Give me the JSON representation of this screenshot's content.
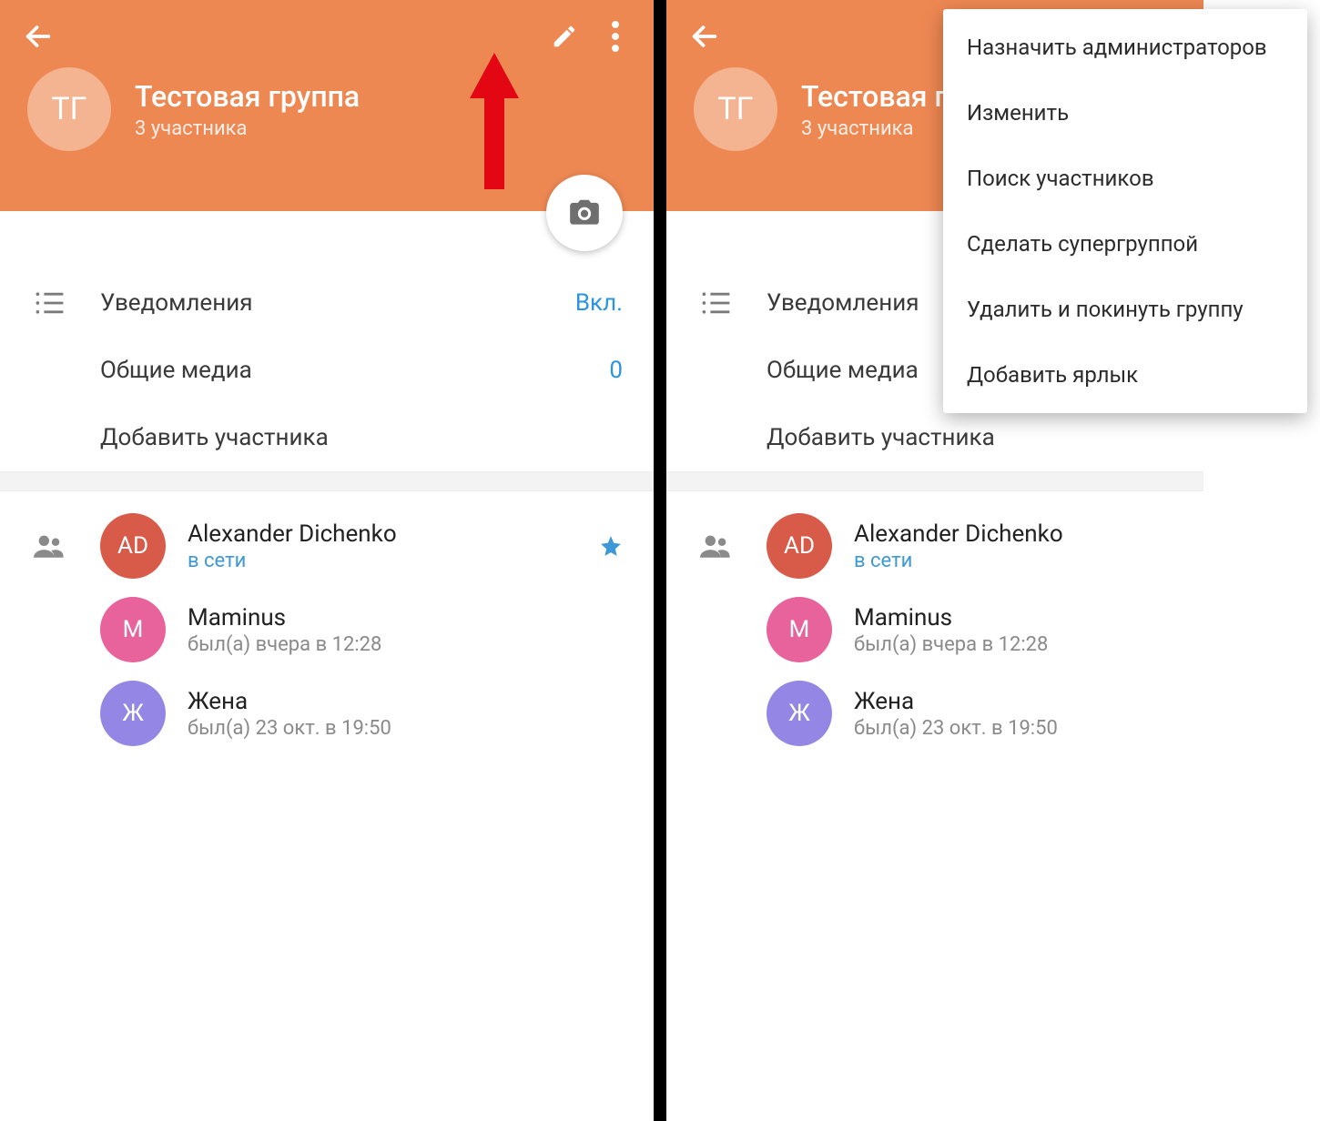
{
  "group": {
    "avatar_initials": "ТГ",
    "title": "Тестовая группа",
    "subtitle": "3 участника"
  },
  "rows": {
    "notifications_label": "Уведомления",
    "notifications_value": "Вкл.",
    "media_label": "Общие медиа",
    "media_value": "0",
    "add_member_label": "Добавить участника"
  },
  "members": [
    {
      "initials": "AD",
      "name": "Alexander Dichenko",
      "status": "в сети",
      "online": true,
      "starred": true,
      "color": "#d85a49"
    },
    {
      "initials": "M",
      "name": "Maminus",
      "status": "был(а) вчера в 12:28",
      "online": false,
      "starred": false,
      "color": "#e8639b"
    },
    {
      "initials": "Ж",
      "name": "Жена",
      "status": "был(а) 23 окт. в 19:50",
      "online": false,
      "starred": false,
      "color": "#9386e4"
    }
  ],
  "menu": {
    "items": [
      "Назначить администраторов",
      "Изменить",
      "Поиск участников",
      "Сделать супергруппой",
      "Удалить и покинуть группу",
      "Добавить ярлык"
    ]
  }
}
